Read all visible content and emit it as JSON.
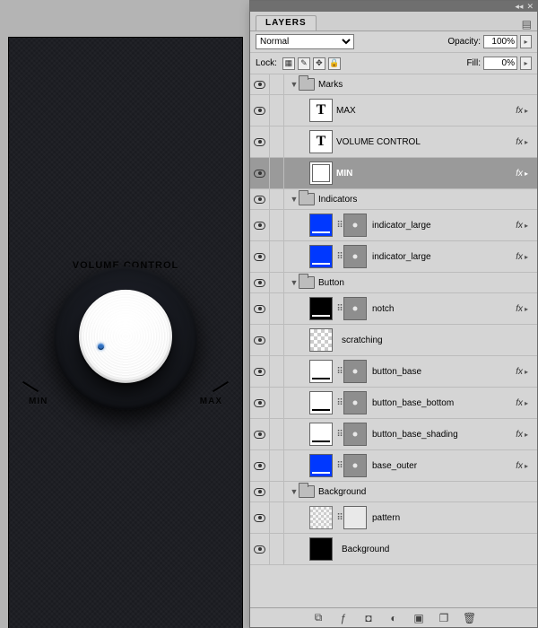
{
  "canvas": {
    "title": "VOLUME CONTROL",
    "min_label": "MIN",
    "max_label": "MAX"
  },
  "panel": {
    "title": "LAYERS",
    "blend_mode": "Normal",
    "opacity_label": "Opacity:",
    "opacity_value": "100%",
    "fill_label": "Fill:",
    "fill_value": "0%",
    "lock_label": "Lock:"
  },
  "groups": {
    "marks": "Marks",
    "indicators": "Indicators",
    "button": "Button",
    "background": "Background"
  },
  "layers": {
    "max": "MAX",
    "volume_control": "VOLUME CONTROL",
    "min": "MIN",
    "indicator_large_1": "indicator_large",
    "indicator_large_2": "indicator_large",
    "notch": "notch",
    "scratching": "scratching",
    "button_base": "button_base",
    "button_base_bottom": "button_base_bottom",
    "button_base_shading": "button_base_shading",
    "base_outer": "base_outer",
    "pattern": "pattern",
    "background": "Background"
  },
  "fx_label": "fx",
  "colors": {
    "accent_blue": "#0038ff",
    "canvas_bg": "#1a1b20",
    "selection": "#9a9a9a"
  }
}
